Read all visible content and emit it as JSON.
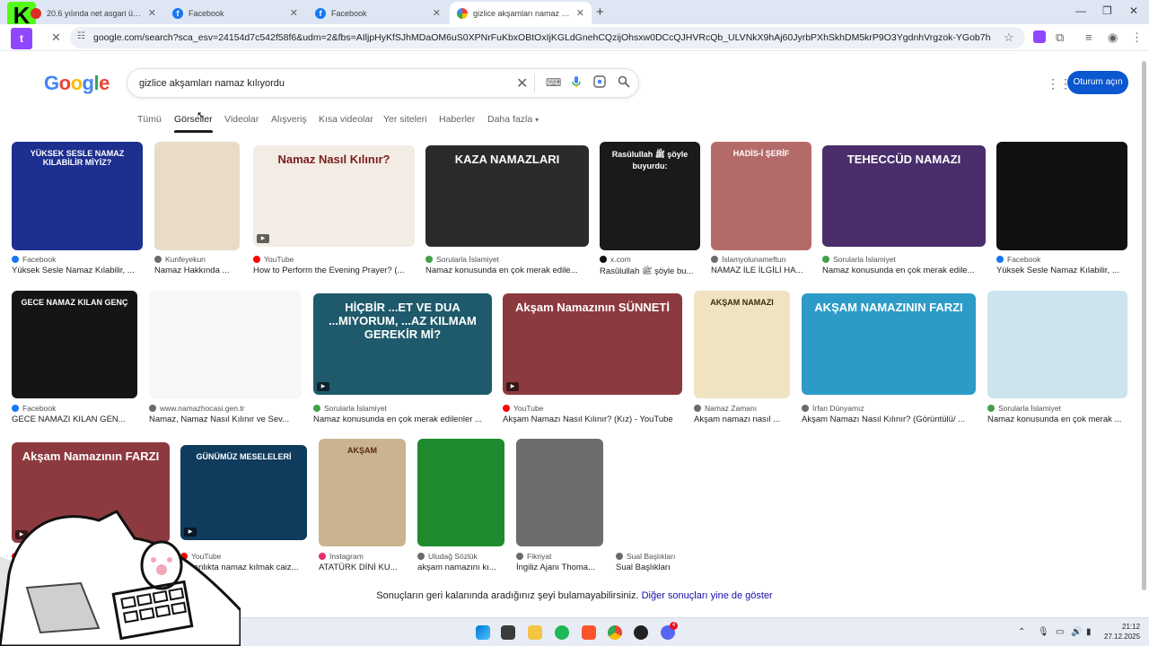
{
  "browser": {
    "tabs": [
      {
        "title": "20.6 yılında net asgari ücret 28...",
        "favicon": "red"
      },
      {
        "title": "Facebook",
        "favicon": "fb"
      },
      {
        "title": "Facebook",
        "favicon": "fb"
      },
      {
        "title": "gizlice akşamları namaz kılıyord",
        "favicon": "g"
      }
    ],
    "new_tab": "+",
    "url": "google.com/search?sca_esv=24154d7c542f58f6&udm=2&fbs=AIljpHyKfSJhMDaOM6uS0XPNrFuKbxOBtOxIjKGLdGnehCQzijOhsxw0DCcQJHVRcQb_ULVNkX9hAj60JyrbPXhSkhDM5krP9O3YgdnhVrgzok-YGob7h4f0WM445z3POMA7o6RdW2Torz..."
  },
  "google": {
    "logo": "Google",
    "query": "gizlice akşamları namaz kılıyordu",
    "signin": "Oturum açın",
    "tabs": [
      "Tümü",
      "Görseller",
      "Videolar",
      "Alışveriş",
      "Kısa videolar",
      "Yer siteleri",
      "Haberler",
      "Daha fazla"
    ]
  },
  "results": [
    {
      "source": "Facebook",
      "caption": "Yüksek Sesle Namaz Kılabilir, ...",
      "thumb_text": "YÜKSEK SESLE NAMAZ KILABİLİR MİYİZ?",
      "bg": "#1d2f8f",
      "fg": "#ffffff"
    },
    {
      "source": "Kunfeyekun",
      "caption": "Namaz Hakkında ...",
      "thumb_text": "",
      "bg": "#e8dcc8",
      "fg": "#333333"
    },
    {
      "source": "YouTube",
      "caption": "How to Perform the Evening Prayer? (...",
      "thumb_text": "Namaz Nasıl Kılınır?",
      "bg": "#f3ece4",
      "fg": "#7a1f1f"
    },
    {
      "source": "Sorularla İslamiyet",
      "caption": "Namaz konusunda en çok merak edile...",
      "thumb_text": "KAZA NAMAZLARI",
      "bg": "#2b2b2b",
      "fg": "#ffffff"
    },
    {
      "source": "x.com",
      "caption": "Rasûlullah ﷺ şöyle bu...",
      "thumb_text": "Rasûlullah ﷺ şöyle buyurdu:",
      "bg": "#1a1a1a",
      "fg": "#ffffff"
    },
    {
      "source": "İslamyolunameftun",
      "caption": "NAMAZ İLE İLGİLİ HA...",
      "thumb_text": "HADİS-İ ŞERİF",
      "bg": "#b56a6a",
      "fg": "#ffffff"
    },
    {
      "source": "Sorularla İslamiyet",
      "caption": "Namaz konusunda en çok merak edile...",
      "thumb_text": "TEHECCÜD NAMAZI",
      "bg": "#4a2e6b",
      "fg": "#ffffff"
    },
    {
      "source": "Facebook",
      "caption": "Yüksek Sesle Namaz Kılabilir, ...",
      "thumb_text": "",
      "bg": "#111111",
      "fg": "#f5e14a"
    },
    {
      "source": "Facebook",
      "caption": "GECE NAMAZI KILAN GEN...",
      "thumb_text": "GECE NAMAZ KILAN GENÇ",
      "bg": "#151515",
      "fg": "#ffffff"
    },
    {
      "source": "www.namazhocasi.gen.tr",
      "caption": "Namaz, Namaz Nasıl Kılınır ve Sev...",
      "thumb_text": "",
      "bg": "#f7f7f7",
      "fg": "#222222"
    },
    {
      "source": "Sorularla İslamiyet",
      "caption": "Namaz konusunda en çok merak edilenler ...",
      "thumb_text": "HİÇBİR ...ET VE DUA ...MIYORUM, ...AZ KILMAM GEREKİR Mİ?",
      "bg": "#1e5a6b",
      "fg": "#ffffff"
    },
    {
      "source": "YouTube",
      "caption": "Akşam Namazı Nasıl Kılınır? (Kız) - YouTube",
      "thumb_text": "Akşam Namazının SÜNNETİ",
      "bg": "#8c3a3f",
      "fg": "#ffffff"
    },
    {
      "source": "Namaz Zamanı",
      "caption": "Akşam namazı nasıl ...",
      "thumb_text": "AKŞAM NAMAZI",
      "bg": "#efe3c1",
      "fg": "#3a2a10"
    },
    {
      "source": "İrfan Dünyamız",
      "caption": "Akşam Namazı Nasıl Kılınır? (Görüntülü/ ...",
      "thumb_text": "AKŞAM NAMAZININ FARZI",
      "bg": "#2d9bc7",
      "fg": "#ffffff"
    },
    {
      "source": "Sorularla İslamiyet",
      "caption": "Namaz konusunda en çok merak ...",
      "thumb_text": "",
      "bg": "#cde4ef",
      "fg": "#333333"
    },
    {
      "source": "YouTube",
      "caption": "Akşam N...",
      "thumb_text": "Akşam Namazının FARZI",
      "bg": "#8c3a3f",
      "fg": "#ffffff"
    },
    {
      "source": "YouTube",
      "caption": "Karanlıkta namaz kılmak caiz...",
      "thumb_text": "GÜNÜMÜZ MESELELERİ",
      "bg": "#0f3b5c",
      "fg": "#ffffff"
    },
    {
      "source": "Instagram",
      "caption": "ATATÜRK DİNİ KU...",
      "thumb_text": "AKŞAM",
      "bg": "#c9b48f",
      "fg": "#5a2a10"
    },
    {
      "source": "Uludağ Sözlük",
      "caption": "akşam namazını kı...",
      "thumb_text": "",
      "bg": "#1f8a2e",
      "fg": "#ffffff"
    },
    {
      "source": "Fikriyat",
      "caption": "İngiliz Ajanı Thoma...",
      "thumb_text": "",
      "bg": "#6d6d6d",
      "fg": "#ffffff"
    },
    {
      "source": "Sual Başlıkları",
      "caption": "Sual Başlıkları",
      "thumb_text": "",
      "bg": "#ffffff",
      "fg": "#333333"
    }
  ],
  "footer": {
    "text": "Sonuçların geri kalanında aradığınız şeyi bulamayabilirsiniz.",
    "link": "Diğer sonuçları yine de göster"
  },
  "taskbar": {
    "time": "21:12",
    "date": "27.12.2025",
    "badge": "4"
  }
}
